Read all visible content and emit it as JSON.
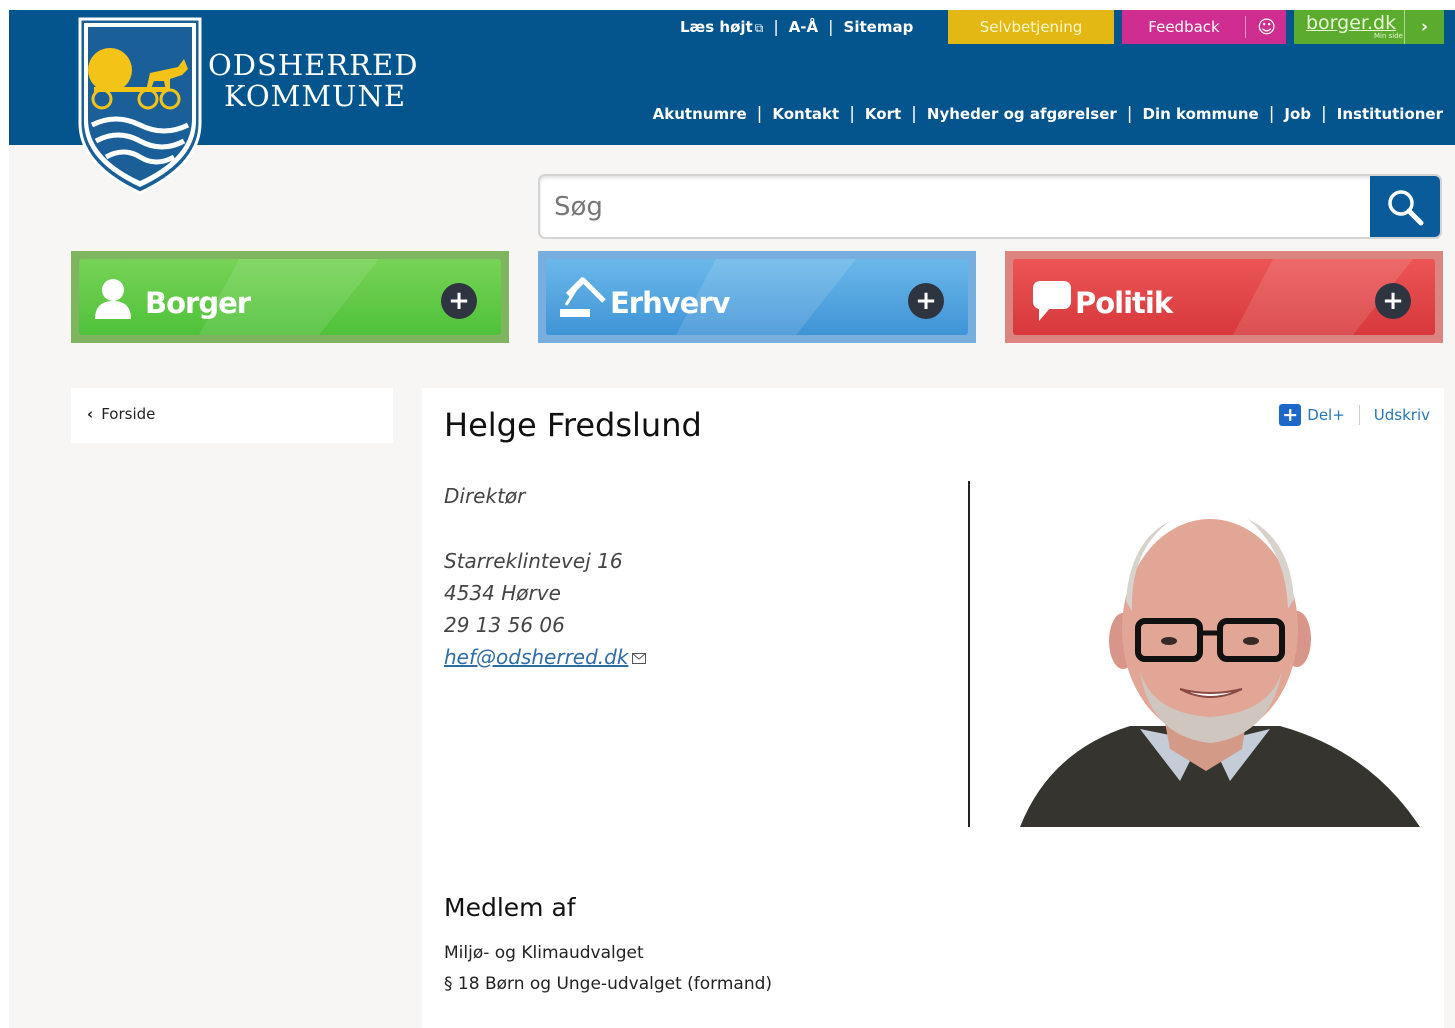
{
  "header": {
    "logo_line1": "ODSHERRED",
    "logo_line2": "KOMMUNE",
    "top_links": [
      "Læs højt",
      "A-Å",
      "Sitemap"
    ],
    "selvbetjening": "Selvbetjening",
    "feedback": "Feedback",
    "borger_dk": "borger.dk",
    "borger_dk_sub": "Min side",
    "main_nav": [
      "Akutnumre",
      "Kontakt",
      "Kort",
      "Nyheder og afgørelser",
      "Din kommune",
      "Job",
      "Institutioner"
    ],
    "colors": {
      "header_bg": "#04548d",
      "selvbetjening": "#e3b815",
      "feedback": "#cf2d8f",
      "borger": "#5aab2e"
    }
  },
  "search": {
    "placeholder": "Søg",
    "icon": "search-icon"
  },
  "tiles": [
    {
      "label": "Borger",
      "icon": "person-icon",
      "color": "#4fc13a"
    },
    {
      "label": "Erhverv",
      "icon": "gavel-icon",
      "color": "#3f94d6"
    },
    {
      "label": "Politik",
      "icon": "speech-bubble-icon",
      "color": "#d7383c"
    }
  ],
  "sidebar": {
    "back_label": "Forside"
  },
  "profile": {
    "name": "Helge Fredslund",
    "role": "Direktør",
    "address_line1": "Starreklintevej 16",
    "address_line2": "4534 Hørve",
    "phone": "29 13 56 06",
    "email": "hef@odsherred.dk"
  },
  "actions": {
    "share": "Del+",
    "print": "Udskriv"
  },
  "membership": {
    "heading": "Medlem af",
    "items": [
      "Miljø- og Klimaudvalget",
      "§ 18 Børn og Unge-udvalget (formand)"
    ]
  }
}
